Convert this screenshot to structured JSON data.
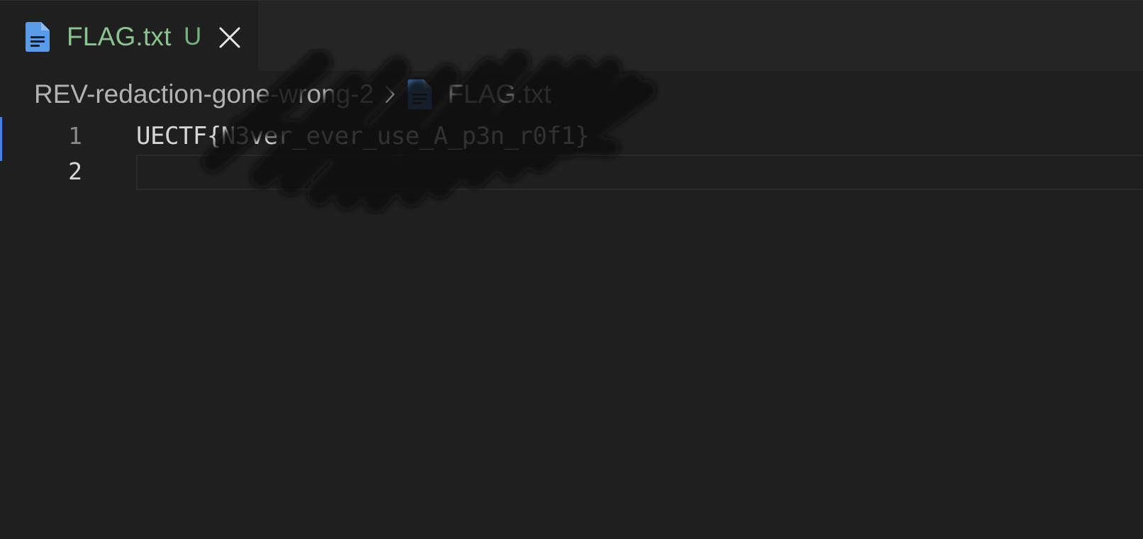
{
  "tab": {
    "filename": "FLAG.txt",
    "status_badge": "U",
    "file_icon": "file-text-icon",
    "close_icon": "close-icon"
  },
  "breadcrumb": {
    "folder": "REV-redaction-gone-wrong-2",
    "separator_icon": "chevron-right-icon",
    "file_icon": "file-text-icon",
    "file": "FLAG.txt"
  },
  "editor": {
    "lines": [
      {
        "number": "1",
        "text": "UECTF{N3ver_ever_use_A_p3n_r0f1}"
      },
      {
        "number": "2",
        "text": ""
      }
    ]
  },
  "colors": {
    "background": "#1f1f1f",
    "tabbar": "#252526",
    "untracked_green": "#89c48e",
    "file_icon_blue": "#5a9be8",
    "active_line_indicator": "#3f85e6"
  }
}
